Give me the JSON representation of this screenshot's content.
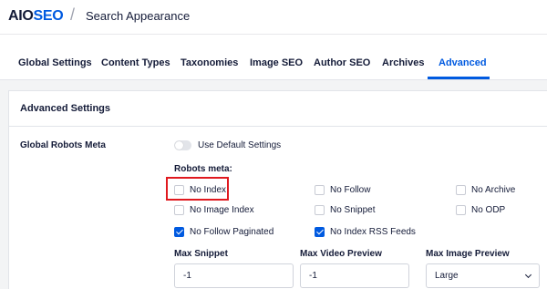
{
  "header": {
    "logo_prefix": "AIO",
    "logo_suffix": "SEO",
    "separator": "/",
    "page_title": "Search Appearance"
  },
  "tabs": [
    {
      "label": "Global Settings",
      "active": false
    },
    {
      "label": "Content Types",
      "active": false
    },
    {
      "label": "Taxonomies",
      "active": false
    },
    {
      "label": "Image SEO",
      "active": false
    },
    {
      "label": "Author SEO",
      "active": false
    },
    {
      "label": "Archives",
      "active": false
    },
    {
      "label": "Advanced",
      "active": true
    }
  ],
  "card": {
    "title": "Advanced Settings",
    "row_label": "Global Robots Meta",
    "toggle_label": "Use Default Settings",
    "toggle_on": false,
    "robots_label": "Robots meta:",
    "checkboxes": [
      {
        "label": "No Index",
        "checked": false
      },
      {
        "label": "No Follow",
        "checked": false
      },
      {
        "label": "No Archive",
        "checked": false
      },
      {
        "label": "No Image Index",
        "checked": false
      },
      {
        "label": "No Snippet",
        "checked": false
      },
      {
        "label": "No ODP",
        "checked": false
      },
      {
        "label": "No Follow Paginated",
        "checked": true
      },
      {
        "label": "No Index RSS Feeds",
        "checked": true
      }
    ],
    "fields": [
      {
        "label": "Max Snippet",
        "value": "-1"
      },
      {
        "label": "Max Video Preview",
        "value": "-1"
      },
      {
        "label": "Max Image Preview",
        "value": "Large"
      }
    ]
  },
  "colors": {
    "accent": "#005ae0",
    "highlight": "#e0191f",
    "text": "#141b38"
  }
}
